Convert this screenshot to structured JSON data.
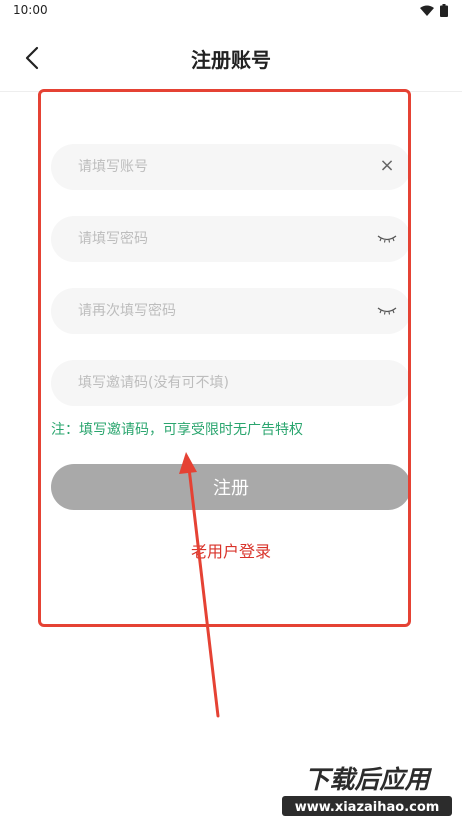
{
  "status_bar": {
    "time": "10:00"
  },
  "header": {
    "title": "注册账号"
  },
  "form": {
    "account_placeholder": "请填写账号",
    "password_placeholder": "请填写密码",
    "confirm_placeholder": "请再次填写密码",
    "invite_placeholder": "填写邀请码(没有可不填)",
    "clear_symbol": "×"
  },
  "notice": "注：填写邀请码，可享受限时无广告特权",
  "register_label": "注册",
  "login_link": "老用户登录",
  "watermark": {
    "title": "下载后应用",
    "url": "www.xiazaihao.com"
  },
  "colors": {
    "annotation": "#e54234",
    "notice": "#2aa56e",
    "login_link": "#d9342b",
    "button_bg": "#a9a9a9"
  },
  "icons": [
    "wifi-icon",
    "battery-icon",
    "back-arrow-icon",
    "clear-icon",
    "eye-closed-icon"
  ]
}
